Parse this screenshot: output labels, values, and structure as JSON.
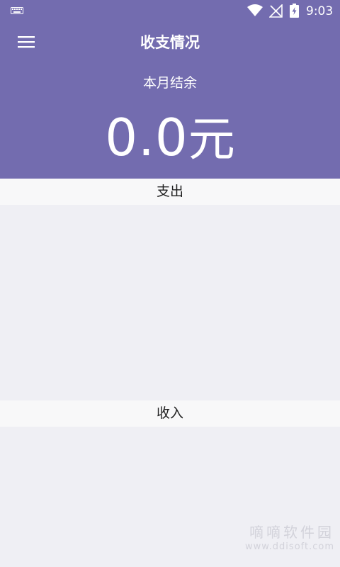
{
  "status_bar": {
    "time": "9:03",
    "icons": [
      "keyboard-icon",
      "wifi-icon",
      "signal-off-icon",
      "battery-charging-icon"
    ]
  },
  "header": {
    "menu_icon": "hamburger-menu-icon",
    "title": "收支情况",
    "balance_label": "本月结余",
    "balance_amount": "0.0",
    "balance_unit": "元",
    "background_color": "#736caf"
  },
  "sections": {
    "expense": {
      "title": "支出"
    },
    "income": {
      "title": "收入"
    }
  },
  "watermark": {
    "main": "嘀嘀软件园",
    "sub": "www.ddisoft.com"
  },
  "colors": {
    "accent": "#736caf",
    "section_header_bg": "#f8f8f9",
    "content_bg": "#efeff4"
  }
}
